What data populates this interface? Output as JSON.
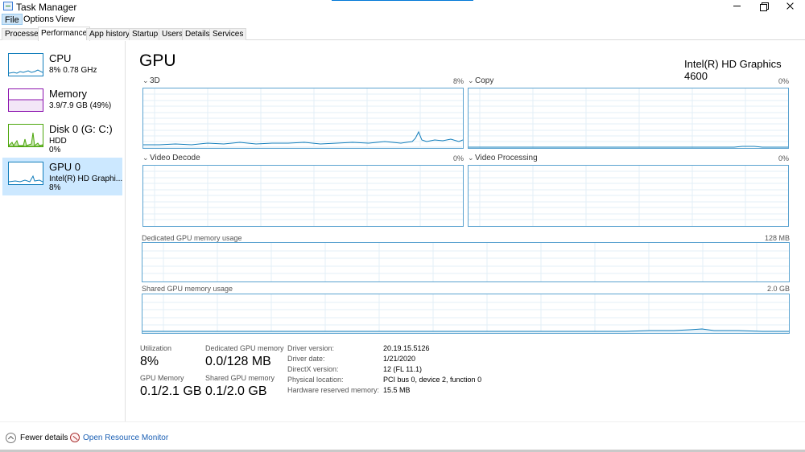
{
  "window": {
    "title": "Task Manager"
  },
  "menu": {
    "file": "File",
    "options": "Options",
    "view": "View"
  },
  "tabs": [
    "Processes",
    "Performance",
    "App history",
    "Startup",
    "Users",
    "Details",
    "Services"
  ],
  "sidebar": {
    "items": [
      {
        "name": "CPU",
        "line1": "8%  0.78 GHz",
        "line2": "",
        "color": "#117dbb"
      },
      {
        "name": "Memory",
        "line1": "3.9/7.9 GB (49%)",
        "line2": "",
        "color": "#8b12ae"
      },
      {
        "name": "Disk 0 (G: C:)",
        "line1": "HDD",
        "line2": "0%",
        "color": "#4da60c"
      },
      {
        "name": "GPU 0",
        "line1": "Intel(R) HD Graphi...",
        "line2": "8%",
        "color": "#117dbb"
      }
    ]
  },
  "main": {
    "title": "GPU",
    "model": "Intel(R) HD Graphics 4600",
    "engines": [
      {
        "label": "3D",
        "pct": "8%"
      },
      {
        "label": "Copy",
        "pct": "0%"
      },
      {
        "label": "Video Decode",
        "pct": "0%"
      },
      {
        "label": "Video Processing",
        "pct": "0%"
      }
    ],
    "dedicated": {
      "label": "Dedicated GPU memory usage",
      "max": "128 MB"
    },
    "shared": {
      "label": "Shared GPU memory usage",
      "max": "2.0 GB"
    }
  },
  "stats": {
    "utilization": {
      "label": "Utilization",
      "value": "8%"
    },
    "dedicated_mem": {
      "label": "Dedicated GPU memory",
      "value": "0.0/128 MB"
    },
    "gpu_memory": {
      "label": "GPU Memory",
      "value": "0.1/2.1 GB"
    },
    "shared_mem": {
      "label": "Shared GPU memory",
      "value": "0.1/2.0 GB"
    }
  },
  "info": [
    {
      "key": "Driver version:",
      "value": "20.19.15.5126"
    },
    {
      "key": "Driver date:",
      "value": "1/21/2020"
    },
    {
      "key": "DirectX version:",
      "value": "12 (FL 11.1)"
    },
    {
      "key": "Physical location:",
      "value": "PCI bus 0, device 2, function 0"
    },
    {
      "key": "Hardware reserved memory:",
      "value": "15.5 MB"
    }
  ],
  "footer": {
    "fewer_details": "Fewer details",
    "open_monitor": "Open Resource Monitor"
  },
  "colors": {
    "accent": "#0078d7",
    "graph_line": "#117dbb",
    "graph_border": "#5ba3d0",
    "selected_bg": "#cce8ff"
  }
}
